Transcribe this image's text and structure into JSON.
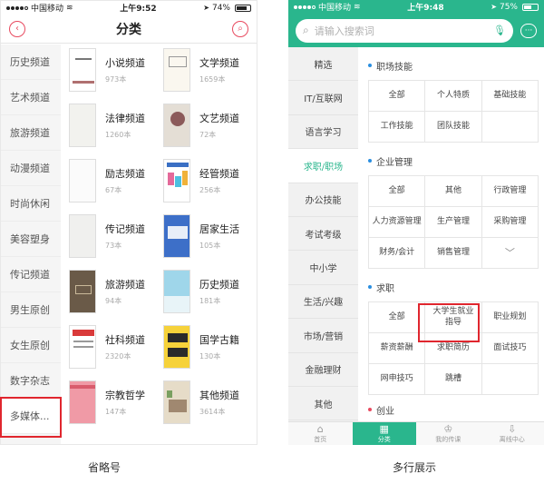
{
  "left": {
    "status": {
      "carrier": "中国移动",
      "time": "上午9:52",
      "battery": "74%"
    },
    "title": "分类",
    "sidebar": [
      "历史频道",
      "艺术频道",
      "旅游频道",
      "动漫频道",
      "时尚休闲",
      "美容塑身",
      "传记频道",
      "男生原创",
      "女生原创",
      "数字杂志",
      "多媒体..."
    ],
    "books": [
      {
        "name": "小说频道",
        "count": "973本"
      },
      {
        "name": "文学频道",
        "count": "1659本"
      },
      {
        "name": "法律频道",
        "count": "1260本"
      },
      {
        "name": "文艺频道",
        "count": "72本"
      },
      {
        "name": "励志频道",
        "count": "67本"
      },
      {
        "name": "经管频道",
        "count": "256本"
      },
      {
        "name": "传记频道",
        "count": "73本"
      },
      {
        "name": "居家生活",
        "count": "105本"
      },
      {
        "name": "旅游频道",
        "count": "94本"
      },
      {
        "name": "历史频道",
        "count": "181本"
      },
      {
        "name": "社科频道",
        "count": "2320本"
      },
      {
        "name": "国学古籍",
        "count": "130本"
      },
      {
        "name": "宗教哲学",
        "count": "147本"
      },
      {
        "name": "其他频道",
        "count": "3614本"
      }
    ],
    "caption": "省略号"
  },
  "right": {
    "status": {
      "carrier": "中国移动",
      "time": "上午9:48",
      "battery": "75%"
    },
    "search_placeholder": "请输入搜索词",
    "sidebar": [
      "精选",
      "IT/互联网",
      "语言学习",
      "求职/职场",
      "办公技能",
      "考试考级",
      "中小学",
      "生活/兴趣",
      "市场/营销",
      "金融理财",
      "其他"
    ],
    "sections": [
      {
        "title": "职场技能",
        "tags": [
          "全部",
          "个人特质",
          "基础技能",
          "工作技能",
          "团队技能",
          ""
        ]
      },
      {
        "title": "企业管理",
        "tags": [
          "全部",
          "其他",
          "行政管理",
          "人力资源管理",
          "生产管理",
          "采购管理",
          "财务/会计",
          "销售管理",
          "﹀"
        ]
      },
      {
        "title": "求职",
        "tags": [
          "全部",
          "大学生就业指导",
          "职业规划",
          "薪资薪酬",
          "求职简历",
          "面试技巧",
          "网申技巧",
          "跳槽",
          ""
        ]
      },
      {
        "title": "创业",
        "tags": []
      }
    ],
    "tabs": [
      {
        "icon": "⌂",
        "label": "首页"
      },
      {
        "icon": "▦",
        "label": "分类"
      },
      {
        "icon": "♔",
        "label": "我的传课"
      },
      {
        "icon": "⇩",
        "label": "离线中心"
      }
    ],
    "caption": "多行展示"
  },
  "colors": {
    "accent_green": "#2ab68d",
    "accent_red": "#e84a5f",
    "highlight": "#e0262e"
  }
}
